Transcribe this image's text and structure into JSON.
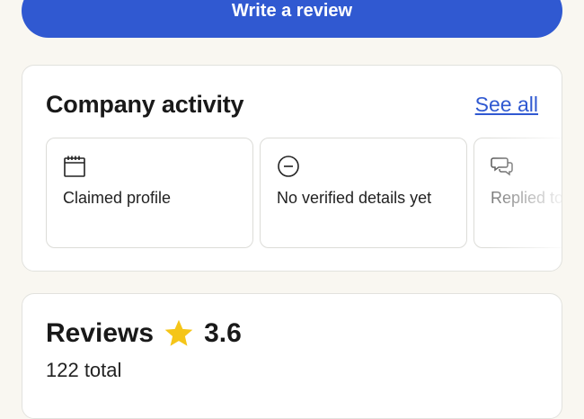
{
  "write_review": {
    "label": "Write a review"
  },
  "activity": {
    "title": "Company activity",
    "see_all": "See all",
    "tiles": [
      {
        "icon": "calendar-icon",
        "label": "Claimed profile"
      },
      {
        "icon": "minus-circle-icon",
        "label": "No verified details yet"
      },
      {
        "icon": "chat-bubbles-icon",
        "label": "Replied to negative"
      }
    ]
  },
  "reviews": {
    "title": "Reviews",
    "rating": "3.6",
    "total": "122 total",
    "star_color": "#f5c518"
  },
  "colors": {
    "accent": "#3059d1",
    "background": "#f9f7f1"
  }
}
